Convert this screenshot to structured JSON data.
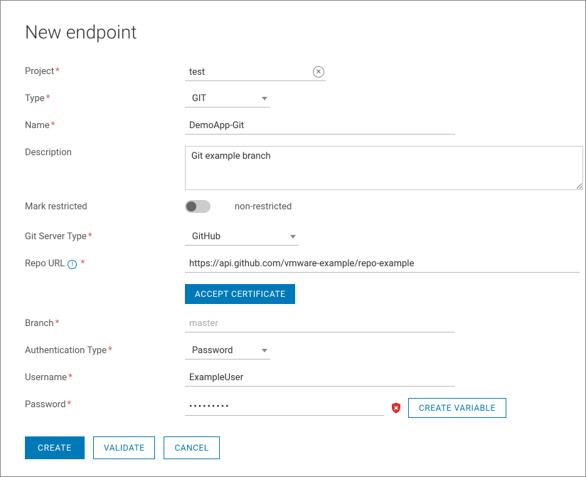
{
  "title": "New endpoint",
  "labels": {
    "project": "Project",
    "type": "Type",
    "name": "Name",
    "description": "Description",
    "mark_restricted": "Mark restricted",
    "git_server_type": "Git Server Type",
    "repo_url": "Repo URL",
    "branch": "Branch",
    "auth_type": "Authentication Type",
    "username": "Username",
    "password": "Password"
  },
  "values": {
    "project": "test",
    "type": "GIT",
    "name": "DemoApp-Git",
    "description": "Git example branch",
    "restricted_status": "non-restricted",
    "git_server_type": "GitHub",
    "repo_url": "https://api.github.com/vmware-example/repo-example",
    "branch_placeholder": "master",
    "auth_type": "Password",
    "username": "ExampleUser",
    "password": "•••••••••"
  },
  "buttons": {
    "accept_cert": "ACCEPT CERTIFICATE",
    "create_variable": "CREATE VARIABLE",
    "create": "CREATE",
    "validate": "VALIDATE",
    "cancel": "CANCEL"
  },
  "icons": {
    "info": "i",
    "clear": "✕"
  }
}
